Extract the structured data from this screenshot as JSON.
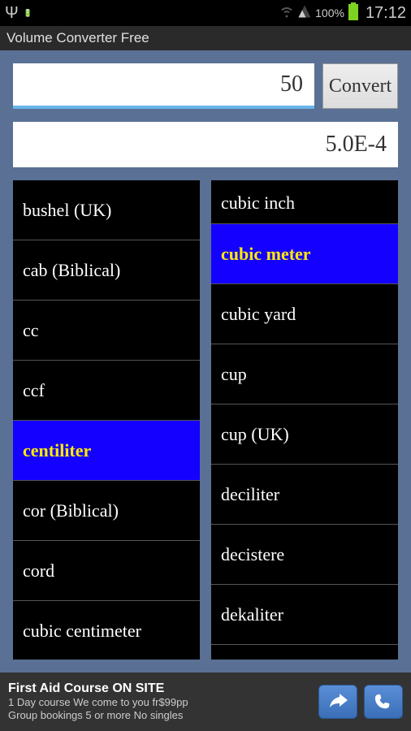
{
  "status": {
    "battery_pct": "100%",
    "time": "17:12"
  },
  "title": "Volume Converter Free",
  "input": {
    "value": "50",
    "convert_label": "Convert",
    "result": "5.0E-4"
  },
  "left_units": [
    {
      "label": "bushel (UK)",
      "selected": false
    },
    {
      "label": "cab (Biblical)",
      "selected": false
    },
    {
      "label": "cc",
      "selected": false
    },
    {
      "label": "ccf",
      "selected": false
    },
    {
      "label": "centiliter",
      "selected": true
    },
    {
      "label": "cor (Biblical)",
      "selected": false
    },
    {
      "label": "cord",
      "selected": false
    },
    {
      "label": "cubic centimeter",
      "selected": false
    }
  ],
  "right_units": [
    {
      "label": "cubic inch",
      "selected": false
    },
    {
      "label": "cubic meter",
      "selected": true
    },
    {
      "label": "cubic yard",
      "selected": false
    },
    {
      "label": "cup",
      "selected": false
    },
    {
      "label": "cup (UK)",
      "selected": false
    },
    {
      "label": "deciliter",
      "selected": false
    },
    {
      "label": "decistere",
      "selected": false
    },
    {
      "label": "dekaliter",
      "selected": false
    }
  ],
  "ad": {
    "title": "First Aid Course ON SITE",
    "line1": "1 Day course We come to you fr$99pp",
    "line2": "Group bookings 5 or more No singles"
  }
}
